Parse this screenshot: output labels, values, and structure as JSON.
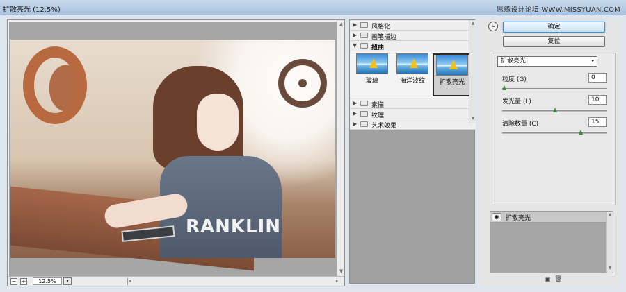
{
  "window": {
    "title": "扩散亮光 (12.5%)",
    "watermark": "思缘设计论坛 WWW.MISSYUAN.COM"
  },
  "preview": {
    "zoom_value": "12.5%",
    "zoom_minus": "−",
    "zoom_plus": "+",
    "zoom_caret": "▾",
    "photo_text": "RANKLIN",
    "scroll_up": "▲",
    "scroll_down": "▼",
    "scroll_left": "◂",
    "scroll_right": "▸"
  },
  "gallery": {
    "folders_top": [
      {
        "label": "风格化",
        "expanded": false
      },
      {
        "label": "画笔描边",
        "expanded": false
      },
      {
        "label": "扭曲",
        "expanded": true
      }
    ],
    "thumbnails": [
      {
        "label": "玻璃",
        "selected": false
      },
      {
        "label": "海洋波纹",
        "selected": false
      },
      {
        "label": "扩散亮光",
        "selected": true
      }
    ],
    "folders_bottom": [
      {
        "label": "素描",
        "expanded": false
      },
      {
        "label": "纹理",
        "expanded": false
      },
      {
        "label": "艺术效果",
        "expanded": false
      }
    ],
    "tri_closed": "▶",
    "tri_open": "▼"
  },
  "controls": {
    "collapse_icon": "≈",
    "ok_label": "确定",
    "reset_label": "复位",
    "filter_select": "扩散亮光",
    "select_caret": "▾",
    "params": [
      {
        "label": "粒度 (G)",
        "value": "0",
        "fraction": 0.0
      },
      {
        "label": "发光量 (L)",
        "value": "10",
        "fraction": 0.5
      },
      {
        "label": "清除数量 (C)",
        "value": "15",
        "fraction": 0.75
      }
    ]
  },
  "layers": {
    "items": [
      {
        "name": "扩散亮光",
        "visible_icon": "◉"
      }
    ],
    "new_icon": "▣",
    "delete_icon": "🗑"
  }
}
